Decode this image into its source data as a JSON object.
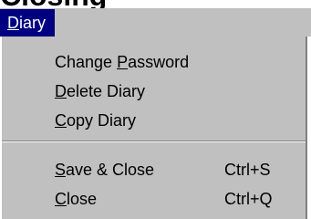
{
  "page": {
    "heading": "Closing"
  },
  "menu": {
    "title_underlined": "D",
    "title_rest": "iary",
    "items": [
      {
        "pre": "Change ",
        "underlined": "P",
        "post": "assword",
        "shortcut": ""
      },
      {
        "pre": "",
        "underlined": "D",
        "post": "elete Diary",
        "shortcut": ""
      },
      {
        "pre": "",
        "underlined": "C",
        "post": "opy Diary",
        "shortcut": ""
      },
      {
        "pre": "",
        "underlined": "S",
        "post": "ave & Close",
        "shortcut": "Ctrl+S"
      },
      {
        "pre": "",
        "underlined": "C",
        "post": "lose",
        "shortcut": "Ctrl+Q"
      }
    ]
  },
  "colors": {
    "menu_background": "#c0c0c0",
    "highlight": "#000080",
    "highlight_text": "#ffffff"
  }
}
